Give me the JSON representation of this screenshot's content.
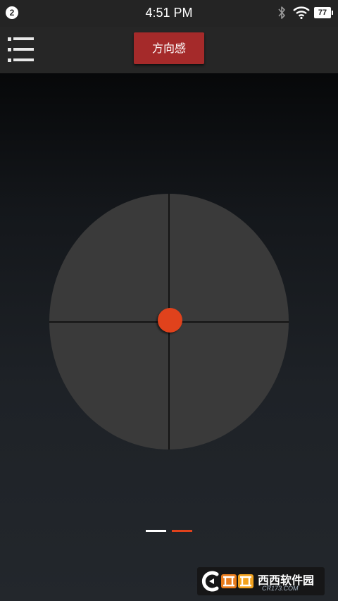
{
  "status_bar": {
    "notification_count": "2",
    "time": "4:51 PM",
    "battery": "77",
    "icons": [
      "bluetooth-icon",
      "wifi-icon",
      "battery-icon"
    ]
  },
  "toolbar": {
    "menu_icon": "menu-icon",
    "direction_button_label": "方向感"
  },
  "joystick": {
    "knob_position": [
      0,
      0
    ]
  },
  "pager": {
    "page_count": 2,
    "current_page": 2,
    "inactive_color": "#ffffff",
    "active_color": "#e0421c"
  },
  "colors": {
    "accent_button": "#a52a2a",
    "knob": "#e0421c",
    "pad": "#3a3a3a"
  },
  "watermark": {
    "name": "西西软件园",
    "domain": "CR173.COM"
  }
}
